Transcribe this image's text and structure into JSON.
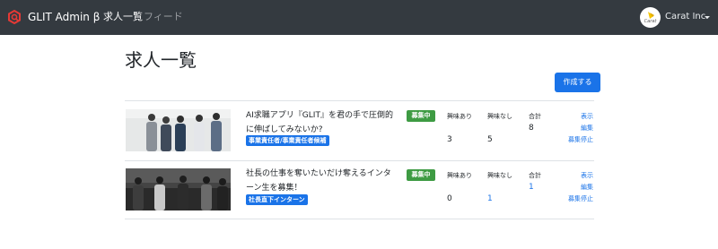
{
  "navbar": {
    "brand": "GLIT Admin β",
    "links": [
      {
        "label": "求人一覧",
        "active": true
      },
      {
        "label": "フィード",
        "active": false
      }
    ],
    "avatar_text": "Carat",
    "company_name": "Carat Inc.",
    "colors": {
      "background": "#343a40",
      "brand_icon": "#e53935"
    }
  },
  "page": {
    "title": "求人一覧",
    "create_button": "作成する"
  },
  "jobs": [
    {
      "title": "AI求職アプリ『GLIT』を君の手で圧倒的に伸ばしてみないか?",
      "tag": "事業責任者/事業責任者候補",
      "status": "募集中",
      "interested_label": "興味あり",
      "interested": "3",
      "not_interested_label": "興味なし",
      "not_interested": "5",
      "total_label": "合計",
      "total": "8",
      "actions": [
        "表示",
        "編集",
        "募集停止"
      ]
    },
    {
      "title": "社長の仕事を奪いたいだけ奪えるインターン生を募集！",
      "tag": "社長直下インターン",
      "status": "募集中",
      "interested_label": "興味あり",
      "interested": "0",
      "not_interested_label": "興味なし",
      "not_interested": "1",
      "total_label": "合計",
      "total": "1",
      "actions": [
        "表示",
        "編集",
        "募集停止"
      ]
    }
  ]
}
